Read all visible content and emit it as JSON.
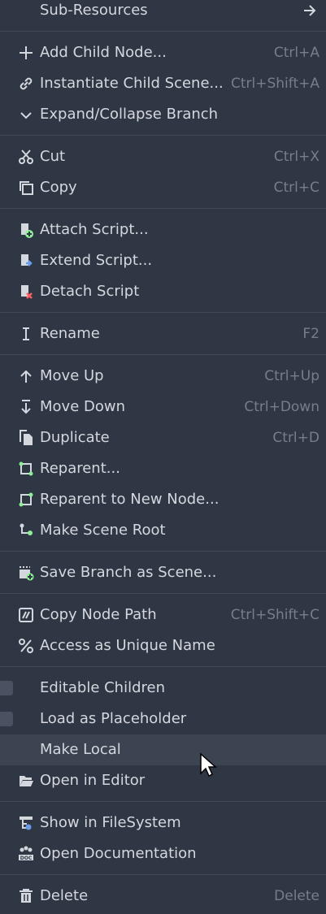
{
  "menu": {
    "sub_resources": {
      "label": "Sub-Resources",
      "icon": "arrow-right-icon"
    },
    "add_child_node": {
      "label": "Add Child Node...",
      "shortcut": "Ctrl+A",
      "icon": "plus-icon"
    },
    "instantiate_child_scene": {
      "label": "Instantiate Child Scene...",
      "shortcut": "Ctrl+Shift+A",
      "icon": "link-icon"
    },
    "expand_collapse_branch": {
      "label": "Expand/Collapse Branch",
      "icon": "chevron-down-icon"
    },
    "cut": {
      "label": "Cut",
      "shortcut": "Ctrl+X",
      "icon": "scissors-icon"
    },
    "copy": {
      "label": "Copy",
      "shortcut": "Ctrl+C",
      "icon": "copy-icon"
    },
    "attach_script": {
      "label": "Attach Script...",
      "icon": "script-add-icon"
    },
    "extend_script": {
      "label": "Extend Script...",
      "icon": "script-extend-icon"
    },
    "detach_script": {
      "label": "Detach Script",
      "icon": "script-remove-icon"
    },
    "rename": {
      "label": "Rename",
      "shortcut": "F2",
      "icon": "text-cursor-icon"
    },
    "move_up": {
      "label": "Move Up",
      "shortcut": "Ctrl+Up",
      "icon": "arrow-up-icon"
    },
    "move_down": {
      "label": "Move Down",
      "shortcut": "Ctrl+Down",
      "icon": "arrow-down-icon"
    },
    "duplicate": {
      "label": "Duplicate",
      "shortcut": "Ctrl+D",
      "icon": "duplicate-icon"
    },
    "reparent": {
      "label": "Reparent...",
      "icon": "reparent-icon"
    },
    "reparent_to_new_node": {
      "label": "Reparent to New Node...",
      "icon": "reparent-new-icon"
    },
    "make_scene_root": {
      "label": "Make Scene Root",
      "icon": "scene-root-icon"
    },
    "save_branch_as_scene": {
      "label": "Save Branch as Scene...",
      "icon": "save-scene-icon"
    },
    "copy_node_path": {
      "label": "Copy Node Path",
      "shortcut": "Ctrl+Shift+C",
      "icon": "node-path-icon"
    },
    "access_as_unique_name": {
      "label": "Access as Unique Name",
      "icon": "percent-icon"
    },
    "editable_children": {
      "label": "Editable Children",
      "checked": false
    },
    "load_as_placeholder": {
      "label": "Load as Placeholder",
      "checked": false
    },
    "make_local": {
      "label": "Make Local"
    },
    "open_in_editor": {
      "label": "Open in Editor",
      "icon": "folder-open-icon"
    },
    "show_in_filesystem": {
      "label": "Show in FileSystem",
      "icon": "filesystem-icon"
    },
    "open_documentation": {
      "label": "Open Documentation",
      "icon": "documentation-icon"
    },
    "delete": {
      "label": "Delete",
      "shortcut": "Delete",
      "icon": "trash-icon"
    }
  },
  "colors": {
    "background": "#2f3644",
    "hover": "#3d4451",
    "text": "#d4d8de",
    "shortcut": "#777e8b",
    "separator": "#424a57",
    "accent_green": "#8eef97",
    "accent_blue": "#699ce8",
    "accent_red": "#ff5f5f"
  }
}
